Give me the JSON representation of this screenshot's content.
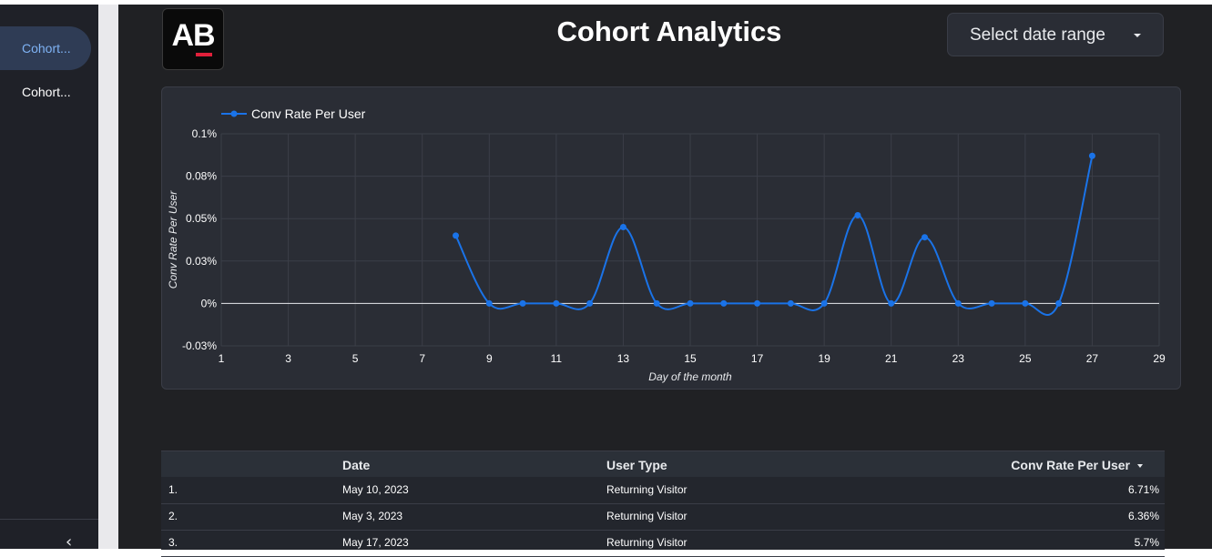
{
  "sidebar": {
    "items": [
      {
        "label": "Cohort..."
      },
      {
        "label": "Cohort..."
      }
    ],
    "collapse_icon": "chevron-left-icon"
  },
  "header": {
    "logo_text": "AB",
    "title": "Cohort Analytics",
    "date_selector": {
      "label": "Select date range",
      "icon": "caret-down-icon"
    }
  },
  "colors": {
    "series": "#1a73e8",
    "background": "#202124",
    "card": "#2a2d35",
    "sidebar_active": "#2f3c55",
    "logo_accent": "#e0203a"
  },
  "chart_data": {
    "type": "line",
    "title": "",
    "xlabel": "Day of the month",
    "ylabel": "Conv Rate Per User",
    "legend": "top-left",
    "grid": true,
    "xlim": [
      1,
      29
    ],
    "xticks": [
      "1",
      "3",
      "5",
      "7",
      "9",
      "11",
      "13",
      "15",
      "17",
      "19",
      "21",
      "23",
      "25",
      "27",
      "29"
    ],
    "ylim": [
      -0.025,
      0.1
    ],
    "yticks": [
      {
        "v": 0.1,
        "label": "0.1%"
      },
      {
        "v": 0.075,
        "label": "0.08%"
      },
      {
        "v": 0.05,
        "label": "0.05%"
      },
      {
        "v": 0.025,
        "label": "0.03%"
      },
      {
        "v": 0,
        "label": "0%"
      },
      {
        "v": -0.025,
        "label": "-0.03%"
      }
    ],
    "series": [
      {
        "name": "Conv Rate Per User",
        "x": [
          8,
          9,
          10,
          11,
          12,
          13,
          14,
          15,
          16,
          17,
          18,
          19,
          20,
          21,
          22,
          23,
          24,
          25,
          26,
          27
        ],
        "y": [
          0.04,
          0,
          0,
          0,
          0,
          0.045,
          0,
          0,
          0,
          0,
          0,
          0,
          0.052,
          0,
          0.039,
          0,
          0,
          0,
          0,
          0.087
        ]
      }
    ]
  },
  "table": {
    "columns": {
      "index": "",
      "date": "Date",
      "user_type": "User Type",
      "conv": "Conv Rate Per User"
    },
    "rows": [
      {
        "idx": "1.",
        "date": "May 10, 2023",
        "user_type": "Returning Visitor",
        "conv": "6.71%"
      },
      {
        "idx": "2.",
        "date": "May 3, 2023",
        "user_type": "Returning Visitor",
        "conv": "6.36%"
      },
      {
        "idx": "3.",
        "date": "May 17, 2023",
        "user_type": "Returning Visitor",
        "conv": "5.7%"
      }
    ]
  }
}
